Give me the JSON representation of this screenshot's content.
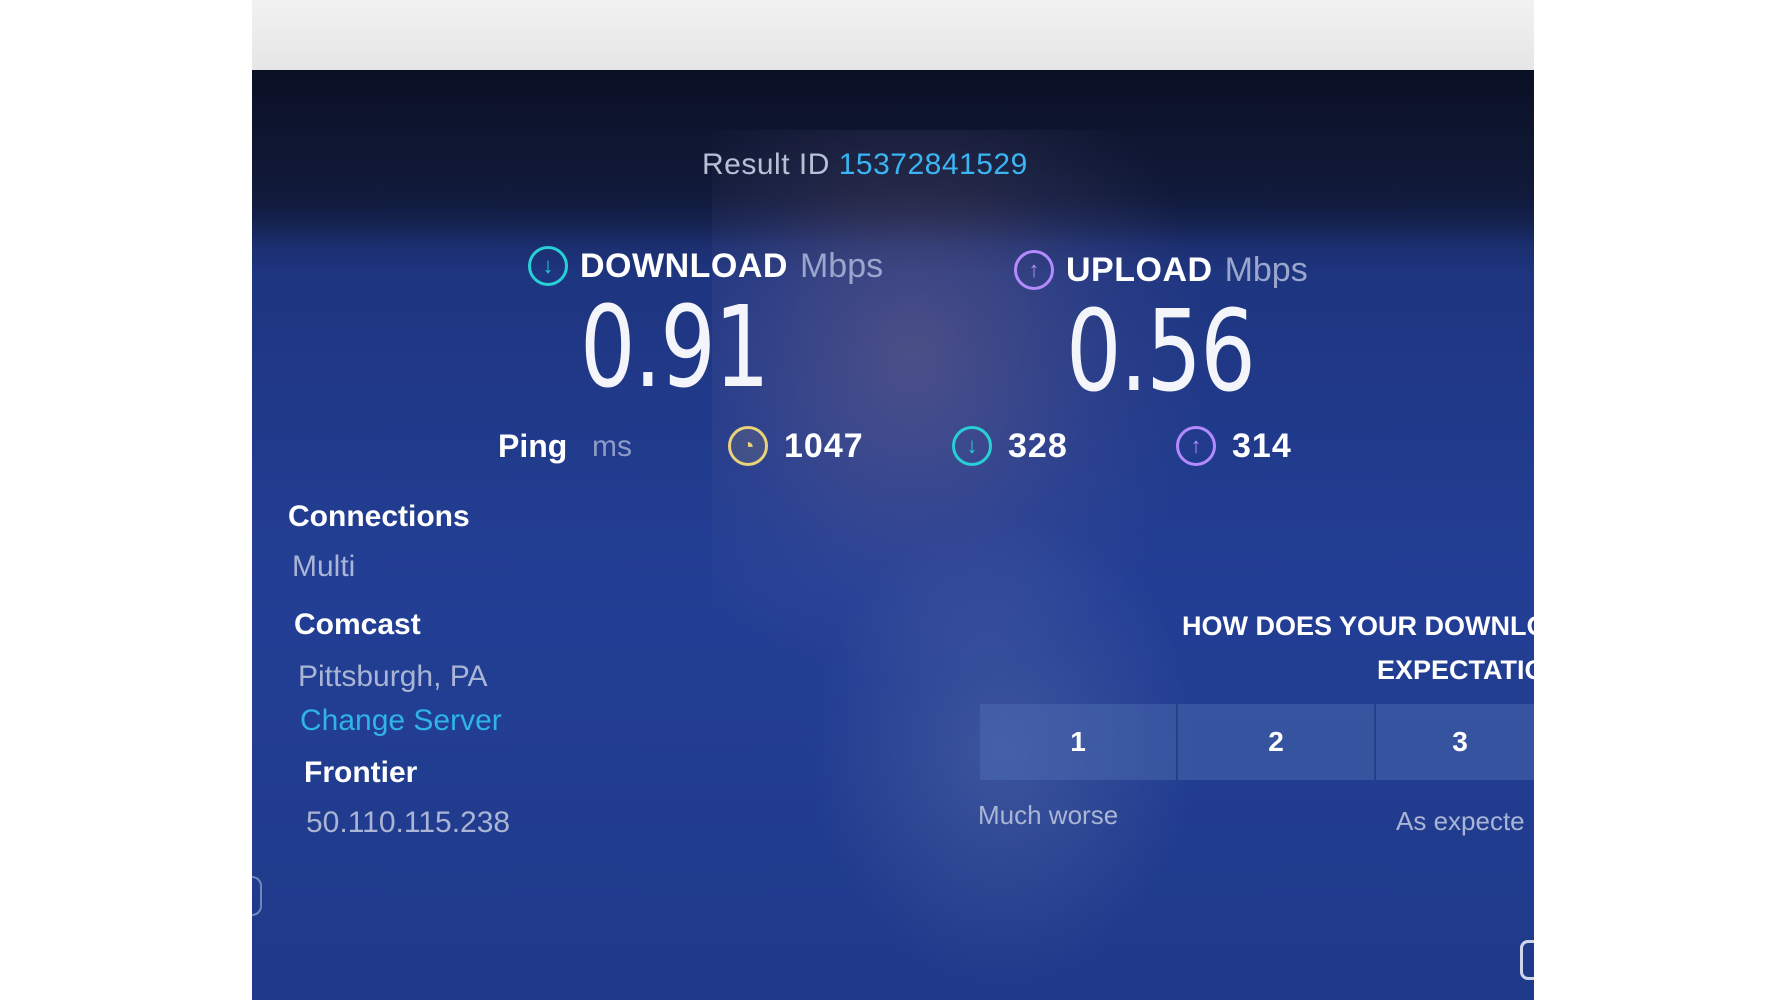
{
  "result": {
    "label": "Result ID",
    "id": "15372841529"
  },
  "download": {
    "label": "DOWNLOAD",
    "unit": "Mbps",
    "value": "0.91",
    "icon": "download-arrow-icon"
  },
  "upload": {
    "label": "UPLOAD",
    "unit": "Mbps",
    "value": "0.56",
    "icon": "upload-arrow-icon"
  },
  "ping": {
    "label": "Ping",
    "unit": "ms",
    "idle": "1047",
    "download": "328",
    "upload": "314"
  },
  "connections": {
    "label": "Connections",
    "value": "Multi"
  },
  "server": {
    "name": "Comcast",
    "location": "Pittsburgh, PA",
    "change_label": "Change Server"
  },
  "provider": {
    "name": "Frontier",
    "ip": "50.110.115.238"
  },
  "survey": {
    "question_line1": "HOW DOES YOUR DOWNLOAD SP",
    "question_line2": "EXPECTATIC",
    "options": [
      "1",
      "2",
      "3"
    ],
    "caption_low": "Much worse",
    "caption_mid": "As expecte"
  },
  "colors": {
    "accent": "#3ab4f2",
    "download": "#28d0d6",
    "upload": "#b48aff",
    "background": "#233f95"
  }
}
